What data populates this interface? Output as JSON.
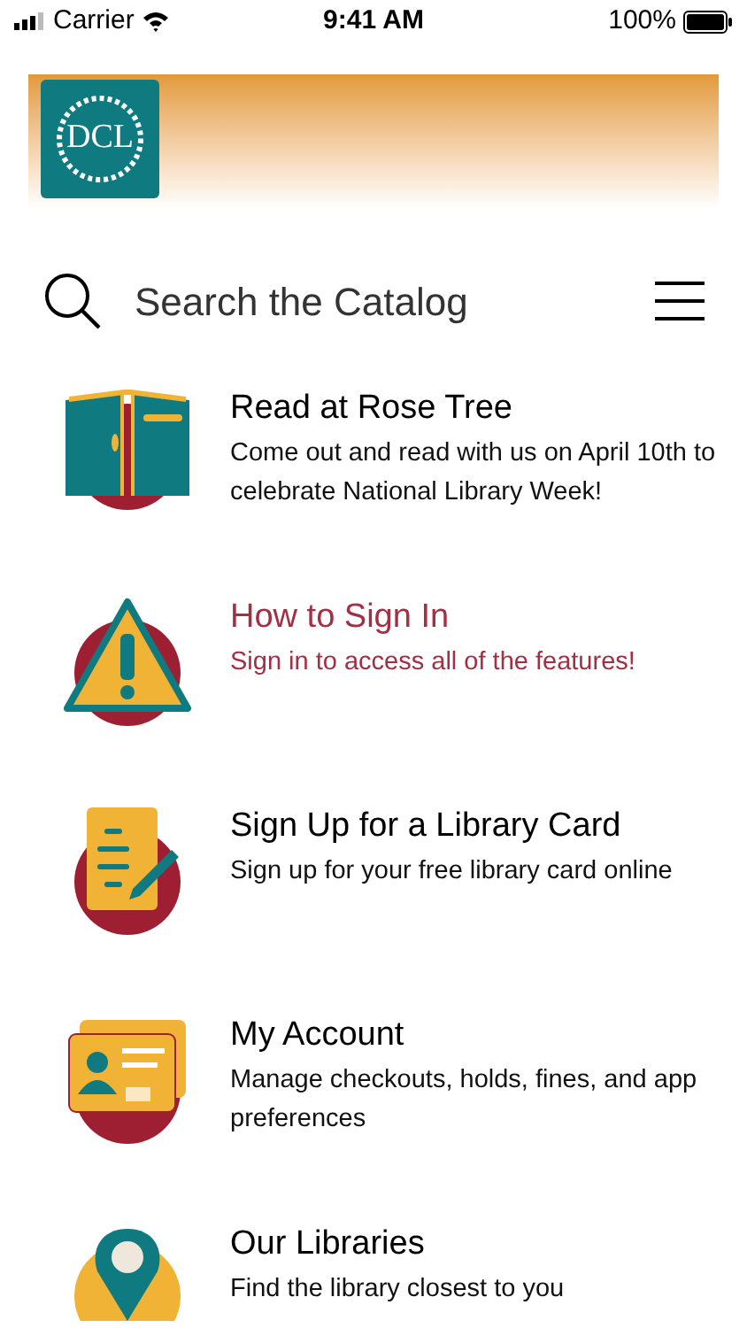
{
  "status_bar": {
    "carrier": "Carrier",
    "time": "9:41 AM",
    "battery": "100%"
  },
  "header": {
    "logo": "DCL"
  },
  "search": {
    "placeholder": "Search the Catalog"
  },
  "items": [
    {
      "kind": "book",
      "title": "Read at Rose Tree",
      "description": "Come out and read with us on April 10th to celebrate National Library Week!",
      "highlighted": false
    },
    {
      "kind": "warning",
      "title": "How to Sign In",
      "description": "Sign in to access all of the features!",
      "highlighted": true
    },
    {
      "kind": "form",
      "title": "Sign Up for a Library Card",
      "description": "Sign up for your free library card online",
      "highlighted": false
    },
    {
      "kind": "card",
      "title": "My Account",
      "description": "Manage checkouts, holds, fines, and app preferences",
      "highlighted": false
    },
    {
      "kind": "pin",
      "title": "Our Libraries",
      "description": "Find the library closest to you",
      "highlighted": false
    }
  ]
}
